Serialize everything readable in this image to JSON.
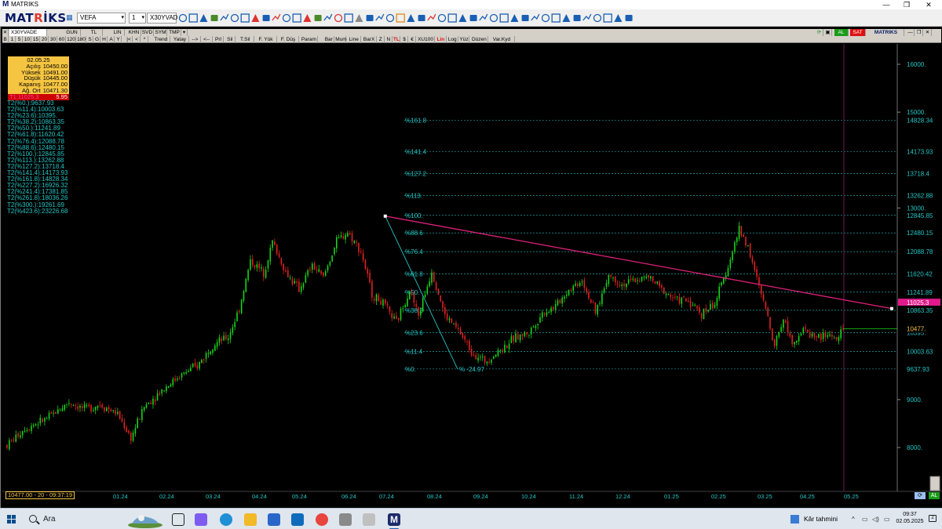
{
  "window": {
    "title": "MATRIKS",
    "min": "—",
    "restore": "❐",
    "close": "✕"
  },
  "toolbar": {
    "brand_pre": "MAT",
    "brand_r": "R",
    "brand_i": "İ",
    "brand_post": "KS",
    "symbol": "VEFA",
    "layout_num": "1",
    "index_symbol": "X30YVAD"
  },
  "header_row1": {
    "symbol": "X30YVADE",
    "period": "GUN",
    "currency": "TL",
    "scale": "LIN",
    "knn": "KHN",
    "svd": "SVD",
    "sym": "SYM",
    "tmp": "TMP",
    "al": "AL",
    "sat": "SAT",
    "brand": "MATRIKS"
  },
  "header_row2": {
    "b": "B",
    "periods": [
      "1",
      "5",
      "10",
      "15",
      "20",
      "30",
      "60",
      "120",
      "180",
      "S",
      "G",
      "H",
      "A",
      "Y"
    ],
    "buttons": [
      "Trend",
      "Yatay",
      "-->",
      "<--",
      "Prl",
      "Sil",
      "T.Sil",
      "F. Yük",
      "F. Düş",
      "Param",
      "Bar",
      "Mum",
      "Line",
      "BarX",
      "Z",
      "N",
      "TL",
      "$",
      "€",
      "XU100",
      "Lin",
      "Log",
      "Yüz",
      "Düzen",
      "Var.Kyd"
    ]
  },
  "info": {
    "date": "02.05.25",
    "rows": [
      {
        "label": "Açılış",
        "value": "10450.00"
      },
      {
        "label": "Yüksek",
        "value": "10491.00"
      },
      {
        "label": "Düşük",
        "value": "10445.00"
      },
      {
        "label": "Kapanış",
        "value": "10477.00"
      },
      {
        "label": "Ağ. Ort",
        "value": "10471.30"
      }
    ],
    "redrow_left": "T1:11025.3",
    "redrow_right": "5.95"
  },
  "fibo_list": [
    "T2(%0.):9637.93",
    "T2(%11.4):10003.63",
    "T2(%23.6):10395.",
    "T2(%38.2):10863.35",
    "T2(%50.):11241.89",
    "T2(%61.8):11620.42",
    "T2(%76.4):12088.78",
    "T2(%88.6):12480.15",
    "T2(%100.):12845.85",
    "T2(%113.):13262.88",
    "T2(%127.2):13718.4",
    "T2(%141.4):14173.93",
    "T2(%161.8):14828.34",
    "T2(%227.2):16926.32",
    "T2(%241.4):17381.85",
    "T2(%261.8):18036.26",
    "T2(%300.):19261.69",
    "T2(%423.6):23226.68"
  ],
  "fibo_levels": [
    {
      "label": "%161.8",
      "value": 14828.34,
      "axis": "14828.34"
    },
    {
      "label": "%141.4",
      "value": 14173.93,
      "axis": "14173.93"
    },
    {
      "label": "%127.2",
      "value": 13718.4,
      "axis": "13718.4"
    },
    {
      "label": "%113.",
      "value": 13262.88,
      "axis": "13262.88"
    },
    {
      "label": "%100.",
      "value": 12845.85,
      "axis": "12845.85"
    },
    {
      "label": "%88.6",
      "value": 12480.15,
      "axis": "12480.15"
    },
    {
      "label": "%76.4",
      "value": 12088.78,
      "axis": "12088.78"
    },
    {
      "label": "%61.8",
      "value": 11620.42,
      "axis": "11620.42"
    },
    {
      "label": "%50.",
      "value": 11241.89,
      "axis": "11241.89"
    },
    {
      "label": "%38.2",
      "value": 10863.35,
      "axis": "10863.35"
    },
    {
      "label": "%23.6",
      "value": 10395,
      "axis": "10395."
    },
    {
      "label": "%11.4",
      "value": 10003.63,
      "axis": "10003.63"
    },
    {
      "label": "%0.",
      "value": 9637.93,
      "axis": "9637.93"
    }
  ],
  "fibo_percent_label": "% -24.97",
  "chart_data": {
    "type": "candlestick",
    "y_ticks": [
      "16000.",
      "15000.",
      "13000.",
      "9000.",
      "8000."
    ],
    "y_tick_values": [
      16000,
      15000,
      13000,
      9000,
      8000
    ],
    "ylim": [
      7400,
      16300
    ],
    "x_labels": [
      "01.24",
      "02.24",
      "03.24",
      "04.24",
      "05.24",
      "06.24",
      "07.24",
      "08.24",
      "09.24",
      "10.24",
      "11.24",
      "12.24",
      "01.25",
      "02.25",
      "03.25",
      "04.25",
      "05.25"
    ],
    "last_price": "10477.",
    "red_marker": "11025.3",
    "path_points": [
      [
        0,
        8050
      ],
      [
        8,
        8400
      ],
      [
        18,
        8600
      ],
      [
        28,
        8950
      ],
      [
        35,
        8800
      ],
      [
        42,
        8900
      ],
      [
        50,
        8700
      ],
      [
        56,
        8200
      ],
      [
        62,
        8850
      ],
      [
        70,
        9200
      ],
      [
        78,
        9500
      ],
      [
        86,
        9700
      ],
      [
        93,
        10150
      ],
      [
        100,
        10300
      ],
      [
        105,
        10900
      ],
      [
        110,
        11900
      ],
      [
        116,
        11650
      ],
      [
        120,
        12300
      ],
      [
        126,
        11650
      ],
      [
        132,
        11300
      ],
      [
        138,
        11800
      ],
      [
        143,
        11550
      ],
      [
        149,
        12300
      ],
      [
        154,
        12500
      ],
      [
        160,
        12100
      ],
      [
        165,
        11200
      ],
      [
        170,
        11000
      ],
      [
        176,
        10600
      ],
      [
        182,
        11300
      ],
      [
        186,
        10750
      ],
      [
        192,
        11700
      ],
      [
        198,
        10750
      ],
      [
        204,
        10450
      ],
      [
        210,
        10000
      ],
      [
        216,
        9800
      ],
      [
        222,
        10000
      ],
      [
        230,
        10300
      ],
      [
        236,
        10400
      ],
      [
        242,
        10800
      ],
      [
        248,
        10950
      ],
      [
        254,
        11300
      ],
      [
        260,
        11500
      ],
      [
        266,
        10800
      ],
      [
        272,
        11600
      ],
      [
        278,
        11400
      ],
      [
        284,
        11500
      ],
      [
        290,
        11550
      ],
      [
        296,
        11300
      ],
      [
        302,
        11100
      ],
      [
        308,
        11050
      ],
      [
        314,
        10800
      ],
      [
        320,
        11000
      ],
      [
        326,
        11800
      ],
      [
        331,
        12550
      ],
      [
        335,
        12200
      ],
      [
        339,
        11500
      ],
      [
        343,
        10900
      ],
      [
        347,
        10150
      ],
      [
        351,
        10700
      ],
      [
        355,
        10200
      ],
      [
        360,
        10450
      ],
      [
        366,
        10300
      ],
      [
        372,
        10350
      ],
      [
        376,
        10250
      ],
      [
        378,
        10477
      ]
    ],
    "trendline": {
      "from": [
        171,
        12830
      ],
      "to": [
        400,
        10900
      ]
    },
    "fibo_drop": {
      "from": [
        171,
        12830
      ],
      "to": [
        203,
        9637.93
      ]
    }
  },
  "status": {
    "bottom_left": "10477.00 - 20 - 09:37:19",
    "al": "AL"
  },
  "taskbar": {
    "search": "Ara",
    "weather": "Kâr tahmini",
    "time": "09:37",
    "date": "02.05.2025",
    "notif_count": "2",
    "apps": [
      "task-view",
      "copilot",
      "edge",
      "file-explorer",
      "store",
      "outlook",
      "chrome",
      "app-a",
      "app-b",
      "matriks"
    ],
    "colors": {
      "matriks": "#1b2b6b",
      "edge": "#1f8fd6",
      "chrome": "#e8453c",
      "outlook": "#0f6cbd",
      "store": "#2a66c9",
      "explorer": "#f2b928",
      "copilot": "#7f5cf0"
    }
  },
  "colors": {
    "cyan": "#25c4c4",
    "up": "#19d419",
    "down": "#e02222",
    "trend": "#e0207a",
    "vline": "#6a1a55"
  }
}
